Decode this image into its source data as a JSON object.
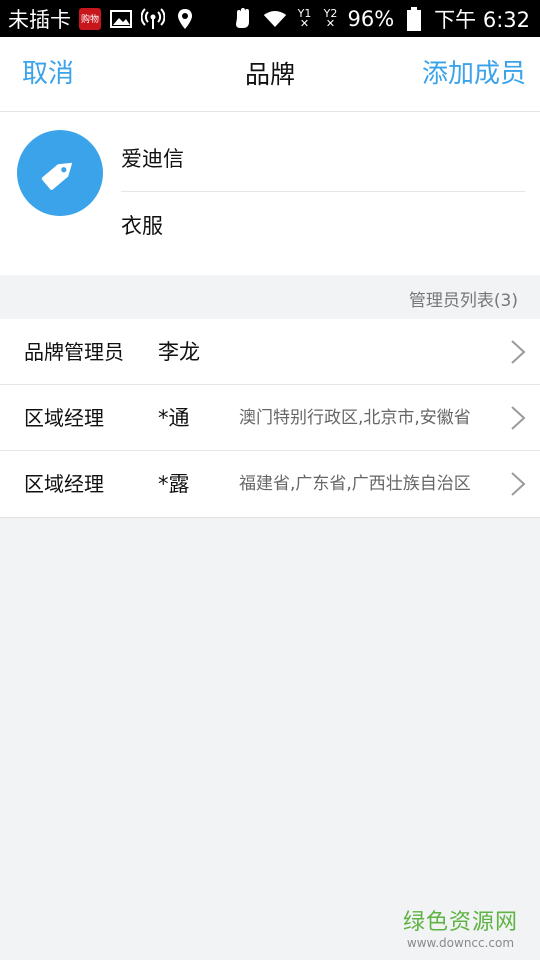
{
  "status_bar": {
    "carrier": "未插卡",
    "badge": "购物",
    "sim1": "Y1",
    "sim2": "Y2",
    "battery": "96%",
    "time": "下午 6:32"
  },
  "nav": {
    "cancel": "取消",
    "title": "品牌",
    "add": "添加成员"
  },
  "brand": {
    "name": "爱迪信",
    "category": "衣服",
    "icon": "tag-icon",
    "accent": "#3aa3ea"
  },
  "section": {
    "header": "管理员列表(3)"
  },
  "admins": [
    {
      "role": "品牌管理员",
      "name": "李龙",
      "region": ""
    },
    {
      "role": "区域经理",
      "name": "*通",
      "region": "澳门特别行政区,北京市,安徽省"
    },
    {
      "role": "区域经理",
      "name": "*露",
      "region": "福建省,广东省,广西壮族自治区"
    }
  ],
  "watermark": {
    "title": "绿色资源网",
    "url": "www.downcc.com"
  }
}
